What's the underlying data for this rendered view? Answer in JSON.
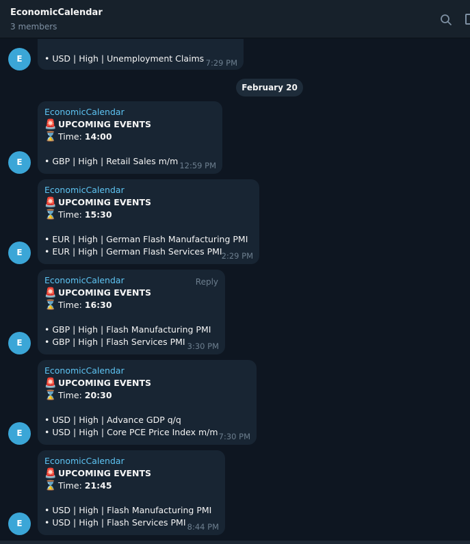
{
  "header": {
    "title": "EconomicCalendar",
    "subtitle": "3 members"
  },
  "date_separator": "February 20",
  "avatar_letter": "E",
  "first_message": {
    "line": "• USD | High | Unemployment Claims",
    "time": "7:29 PM"
  },
  "messages": [
    {
      "sender": "EconomicCalendar",
      "heading": "UPCOMING EVENTS",
      "time_label": "Time: ",
      "time_value": "14:00",
      "events": [
        "• GBP | High | Retail Sales m/m"
      ],
      "timestamp": "12:59 PM"
    },
    {
      "sender": "EconomicCalendar",
      "heading": "UPCOMING EVENTS",
      "time_label": "Time: ",
      "time_value": "15:30",
      "events": [
        "• EUR | High | German Flash Manufacturing PMI",
        "• EUR | High | German Flash Services PMI"
      ],
      "timestamp": "2:29 PM"
    },
    {
      "sender": "EconomicCalendar",
      "heading": "UPCOMING EVENTS",
      "time_label": "Time: ",
      "time_value": "16:30",
      "events": [
        "• GBP | High | Flash Manufacturing PMI",
        "• GBP | High | Flash Services PMI"
      ],
      "timestamp": "3:30 PM",
      "reply_label": "Reply"
    },
    {
      "sender": "EconomicCalendar",
      "heading": "UPCOMING EVENTS",
      "time_label": "Time: ",
      "time_value": "20:30",
      "events": [
        "• USD | High | Advance GDP q/q",
        "• USD | High | Core PCE Price Index m/m"
      ],
      "timestamp": "7:30 PM"
    },
    {
      "sender": "EconomicCalendar",
      "heading": "UPCOMING EVENTS",
      "time_label": "Time: ",
      "time_value": "21:45",
      "events": [
        "• USD | High | Flash Manufacturing PMI",
        "• USD | High | Flash Services PMI"
      ],
      "timestamp": "8:44 PM"
    }
  ],
  "icons": {
    "heading_emoji": "siren-icon",
    "time_emoji": "hourglass-icon"
  },
  "colors": {
    "background": "#0e1621",
    "bubble": "#182533",
    "sender": "#5ec5f4",
    "avatar": "#3ba6d7",
    "timestamp": "#6d7f8f"
  }
}
